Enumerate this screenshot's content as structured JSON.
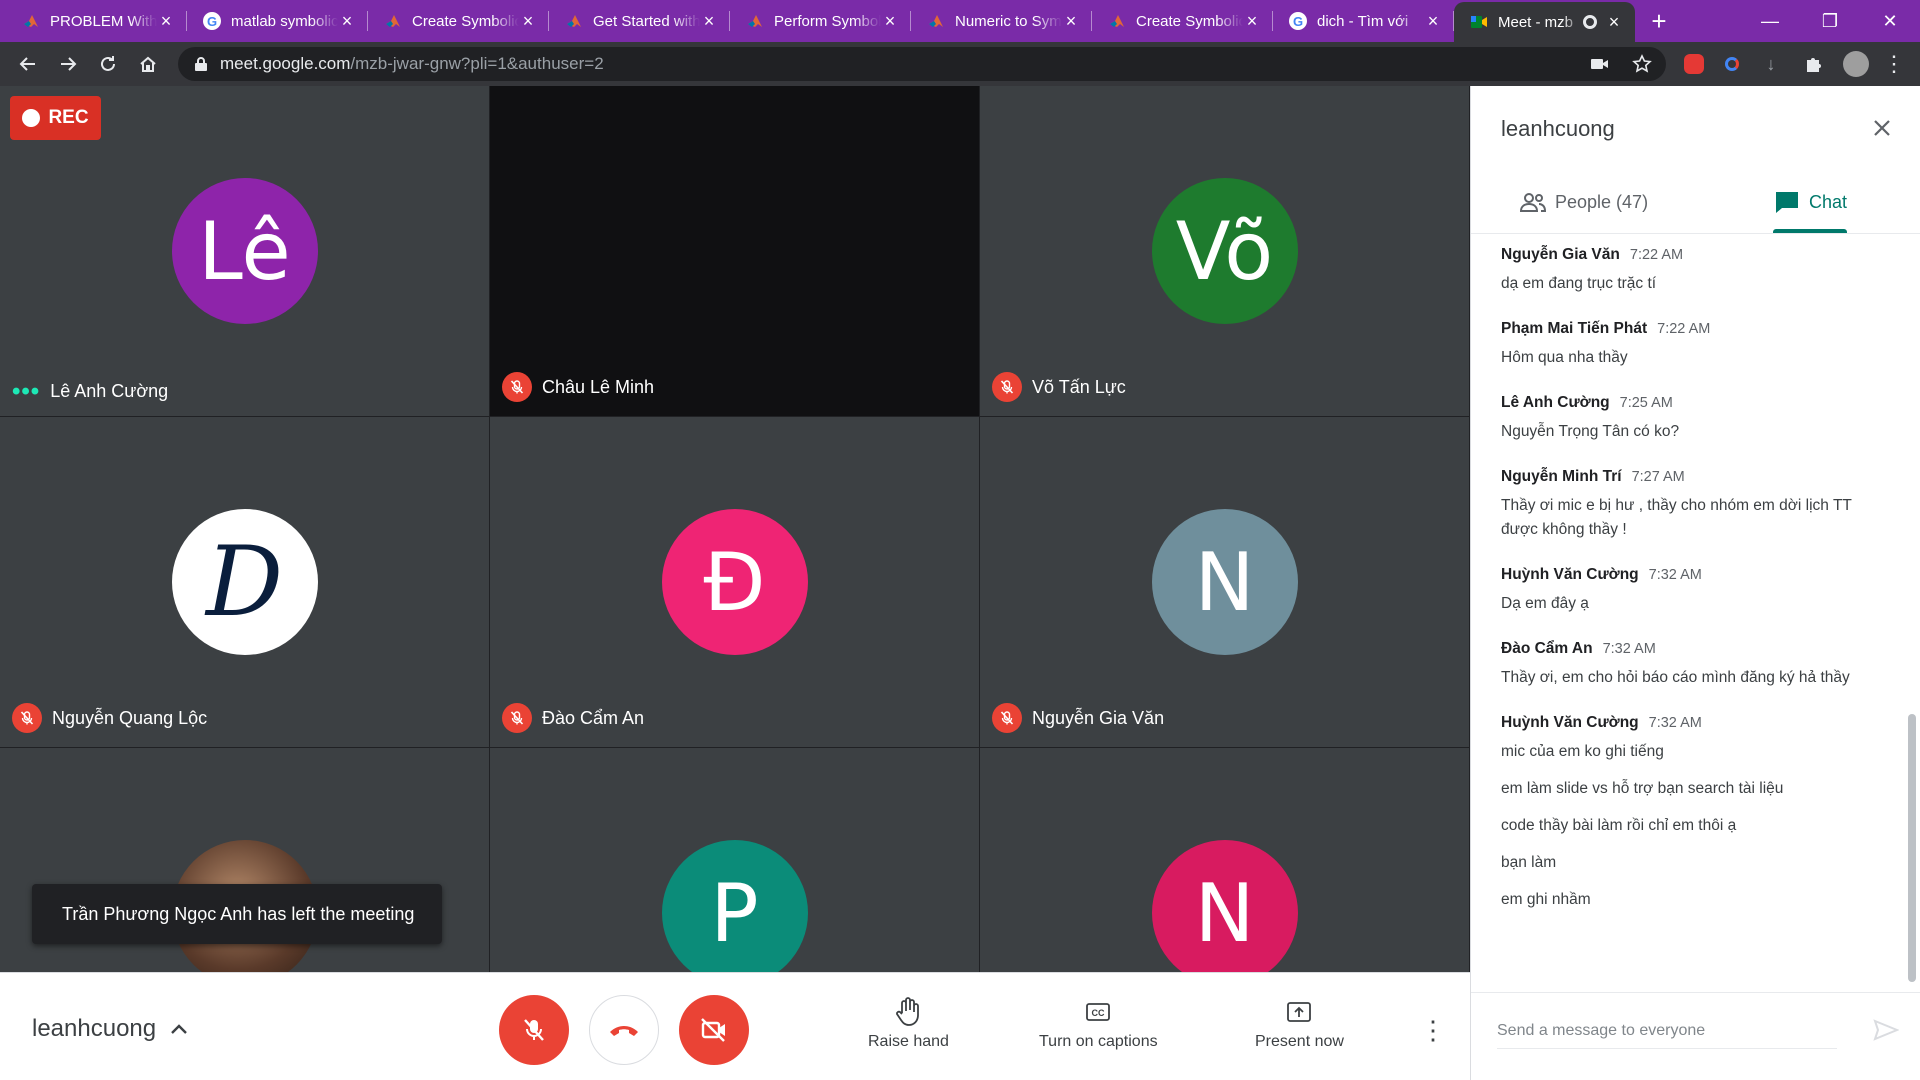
{
  "browser": {
    "tabs": [
      {
        "title": "PROBLEM With",
        "icon": "matlab-icon",
        "active": false
      },
      {
        "title": "matlab symbolic",
        "icon": "google-icon",
        "active": false
      },
      {
        "title": "Create Symbolic",
        "icon": "matlab-icon",
        "active": false
      },
      {
        "title": "Get Started with",
        "icon": "matlab-icon",
        "active": false
      },
      {
        "title": "Perform Symbolic",
        "icon": "matlab-icon",
        "active": false
      },
      {
        "title": "Numeric to Symbolic",
        "icon": "matlab-icon",
        "active": false
      },
      {
        "title": "Create Symbolic",
        "icon": "matlab-icon",
        "active": false
      },
      {
        "title": "dich - Tìm với",
        "icon": "google-icon",
        "active": false
      },
      {
        "title": "Meet - mzb",
        "icon": "meet-icon",
        "active": true
      }
    ],
    "url_host": "meet.google.com",
    "url_path": "/mzb-jwar-gnw?pli=1&authuser=2"
  },
  "meeting": {
    "rec_label": "REC",
    "tiles": [
      {
        "name": "Lê Anh Cường",
        "initial": "Lê",
        "color": "#8e24aa",
        "status": "speaking"
      },
      {
        "name": "Châu Lê Minh",
        "initial": "",
        "color": "#101012",
        "status": "muted"
      },
      {
        "name": "Võ Tấn Lực",
        "initial": "Võ",
        "color": "#1e7b2e",
        "status": "muted"
      },
      {
        "name": "Nguyễn Quang Lộc",
        "initial": "D",
        "color": "#ffffff",
        "status": "muted"
      },
      {
        "name": "Đào Cẩm An",
        "initial": "Đ",
        "color": "#ef2474",
        "status": "muted"
      },
      {
        "name": "Nguyễn Gia Văn",
        "initial": "N",
        "color": "#6f8f9c",
        "status": "muted"
      },
      {
        "name": "",
        "initial": "",
        "color": "#5a3a2a",
        "status": "photo"
      },
      {
        "name": "",
        "initial": "P",
        "color": "#0b8c79",
        "status": "none"
      },
      {
        "name": "",
        "initial": "N",
        "color": "#d81b60",
        "status": "none"
      }
    ],
    "toast": "Trần Phương Ngọc Anh has left the meeting",
    "user_name": "leanhcuong",
    "actions": {
      "raise_hand": "Raise hand",
      "captions": "Turn on captions",
      "present": "Present now"
    }
  },
  "panel": {
    "title": "leanhcuong",
    "people_tab": "People (47)",
    "chat_tab": "Chat",
    "active_tab": "chat",
    "messages": [
      {
        "sender": "Nguyễn Gia Văn",
        "time": "7:22 AM",
        "lines": [
          "dạ em đang trục trặc tí"
        ]
      },
      {
        "sender": "Phạm Mai Tiến Phát",
        "time": "7:22 AM",
        "lines": [
          "Hôm qua nha thầy"
        ]
      },
      {
        "sender": "Lê Anh Cường",
        "time": "7:25 AM",
        "lines": [
          "Nguyễn Trọng Tân có ko?"
        ]
      },
      {
        "sender": "Nguyễn Minh Trí",
        "time": "7:27 AM",
        "lines": [
          "Thầy ơi mic e bị hư , thầy cho nhóm em dời lịch TT được không thầy !"
        ]
      },
      {
        "sender": "Huỳnh Văn Cường",
        "time": "7:32 AM",
        "lines": [
          "Dạ em đây ạ"
        ]
      },
      {
        "sender": "Đào Cẩm An",
        "time": "7:32 AM",
        "lines": [
          "Thầy ơi, em cho hỏi báo cáo mình đăng ký hả thầy"
        ]
      },
      {
        "sender": "Huỳnh Văn Cường",
        "time": "7:32 AM",
        "lines": [
          "mic của em ko ghi tiếng",
          "em làm slide vs hỗ trợ bạn search tài liệu",
          "code thầy bài làm rồi chỉ em thôi ạ",
          "bạn làm",
          "em ghi nhầm"
        ]
      }
    ],
    "input_placeholder": "Send a message to everyone"
  }
}
